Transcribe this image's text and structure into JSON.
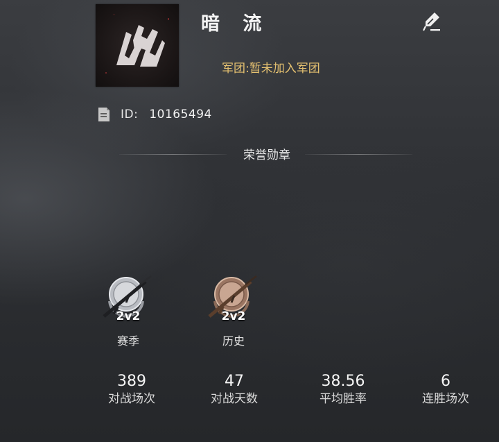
{
  "profile": {
    "name": "暗 流",
    "legion": "军团:暂未加入军团",
    "id_label": "ID:",
    "id_value": "10165494"
  },
  "honor": {
    "title": "荣誉勋章",
    "badges": [
      {
        "level": "2v2",
        "caption": "赛季",
        "tier": "silver"
      },
      {
        "level": "2v2",
        "caption": "历史",
        "tier": "bronze"
      }
    ]
  },
  "stats": [
    {
      "value": "389",
      "label": "对战场次"
    },
    {
      "value": "47",
      "label": "对战天数"
    },
    {
      "value": "38.56",
      "label": "平均胜率"
    },
    {
      "value": "6",
      "label": "连胜场次"
    }
  ],
  "colors": {
    "legion_text": "#e5c170",
    "silver_badge": "#b9bcc2",
    "bronze_badge": "#b08a72"
  },
  "icons": {
    "edit": "quill-pen-icon",
    "id": "document-icon"
  }
}
